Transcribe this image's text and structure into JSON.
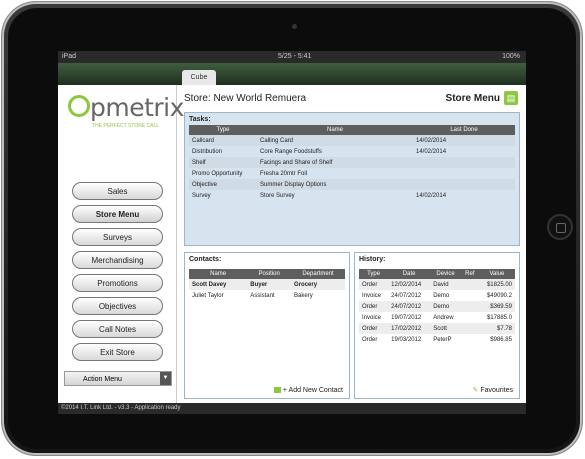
{
  "statusbar": {
    "device": "iPad",
    "time": "5/25 - 5:41",
    "battery": "100%"
  },
  "tab": {
    "label": "Cube"
  },
  "logo": {
    "word": "pmetrix",
    "tagline": "THE PERFECT STORE CALL"
  },
  "sidebar": {
    "buttons": [
      {
        "label": "Sales"
      },
      {
        "label": "Store Menu"
      },
      {
        "label": "Surveys"
      },
      {
        "label": "Merchandising"
      },
      {
        "label": "Promotions"
      },
      {
        "label": "Objectives"
      },
      {
        "label": "Call Notes"
      },
      {
        "label": "Exit Store"
      }
    ],
    "action_menu": "Action Menu"
  },
  "header": {
    "store": "Store: New World Remuera",
    "store_menu": "Store Menu"
  },
  "tasks": {
    "title": "Tasks:",
    "columns": [
      "Type",
      "Name",
      "Last Done"
    ],
    "rows": [
      [
        "Callcard",
        "Calling Card",
        "14/02/2014"
      ],
      [
        "Distribution",
        "Core Range Foodstuffs",
        "14/02/2014"
      ],
      [
        "Shelf",
        "Facings and Share of Shelf",
        ""
      ],
      [
        "Promo Opportunity",
        "Fresha 20mtr Foil",
        ""
      ],
      [
        "Objective",
        "Summer Display Options",
        ""
      ],
      [
        "Survey",
        "Store Survey",
        "14/02/2014"
      ]
    ]
  },
  "contacts": {
    "title": "Contacts:",
    "columns": [
      "Name",
      "Position",
      "Department"
    ],
    "rows": [
      [
        "Scott Davey",
        "Buyer",
        "Grocery"
      ],
      [
        "Juliet Taylor",
        "Assistant",
        "Bakery"
      ]
    ],
    "add": "+ Add New Contact"
  },
  "history": {
    "title": "History:",
    "columns": [
      "Type",
      "Date",
      "Device",
      "Ref",
      "Value"
    ],
    "rows": [
      [
        "Order",
        "12/02/2014",
        "David",
        "",
        "$1825.00"
      ],
      [
        "Invoice",
        "24/07/2012",
        "Demo",
        "",
        "$49090.2"
      ],
      [
        "Order",
        "24/07/2012",
        "Demo",
        "",
        "$369.59"
      ],
      [
        "Invoice",
        "19/07/2012",
        "Andrew",
        "",
        "$17885.0"
      ],
      [
        "Order",
        "17/02/2012",
        "Scott",
        "",
        "$7.78"
      ],
      [
        "Order",
        "19/03/2012",
        "PeterP",
        "",
        "$986.85"
      ]
    ],
    "favourites": "Favourites"
  },
  "footer": {
    "text": "©2014 I.T. Link Ltd. - v3.3 - Application ready"
  }
}
